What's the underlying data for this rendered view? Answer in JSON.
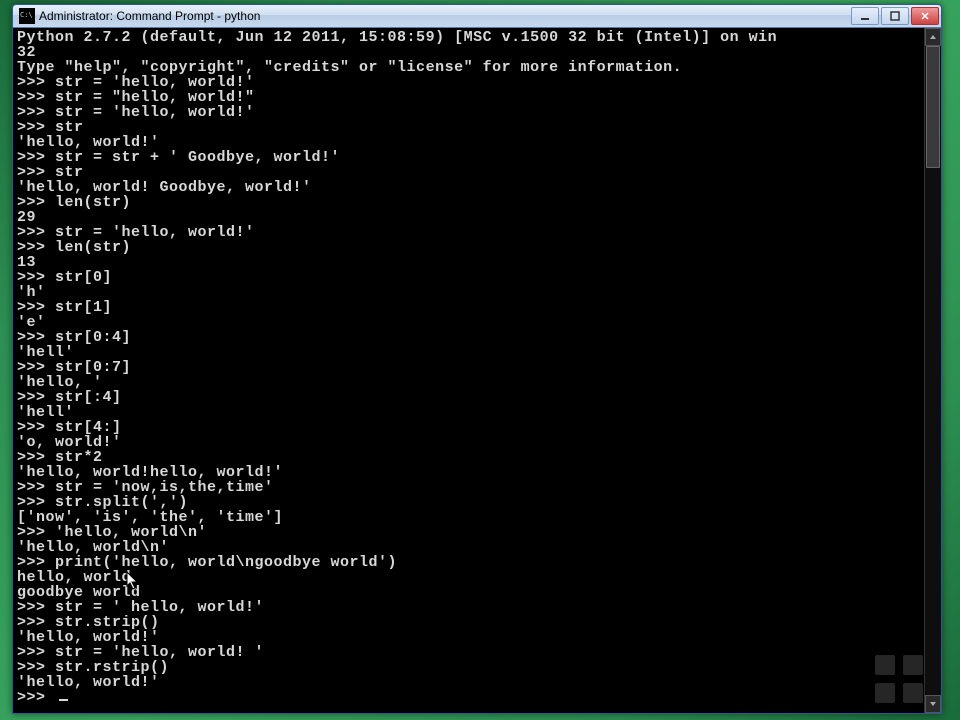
{
  "window": {
    "title": "Administrator: Command Prompt - python"
  },
  "terminal": {
    "lines": [
      "Python 2.7.2 (default, Jun 12 2011, 15:08:59) [MSC v.1500 32 bit (Intel)] on win",
      "32",
      "Type \"help\", \"copyright\", \"credits\" or \"license\" for more information.",
      ">>> str = 'hello, world!'",
      ">>> str = \"hello, world!\"",
      ">>> str = 'hello, world!'",
      ">>> str",
      "'hello, world!'",
      ">>> str = str + ' Goodbye, world!'",
      ">>> str",
      "'hello, world! Goodbye, world!'",
      ">>> len(str)",
      "29",
      ">>> str = 'hello, world!'",
      ">>> len(str)",
      "13",
      ">>> str[0]",
      "'h'",
      ">>> str[1]",
      "'e'",
      ">>> str[0:4]",
      "'hell'",
      ">>> str[0:7]",
      "'hello, '",
      ">>> str[:4]",
      "'hell'",
      ">>> str[4:]",
      "'o, world!'",
      ">>> str*2",
      "'hello, world!hello, world!'",
      ">>> str = 'now,is,the,time'",
      ">>> str.split(',')",
      "['now', 'is', 'the', 'time']",
      ">>> 'hello, world\\n'",
      "'hello, world\\n'",
      ">>> print('hello, world\\ngoodbye world')",
      "hello, world",
      "goodbye world",
      ">>> str = ' hello, world!'",
      ">>> str.strip()",
      "'hello, world!'",
      ">>> str = 'hello, world! '",
      ">>> str.rstrip()",
      "'hello, world!'",
      ">>> "
    ]
  },
  "controls": {
    "minimize": "minimize",
    "maximize": "maximize",
    "close": "close"
  }
}
